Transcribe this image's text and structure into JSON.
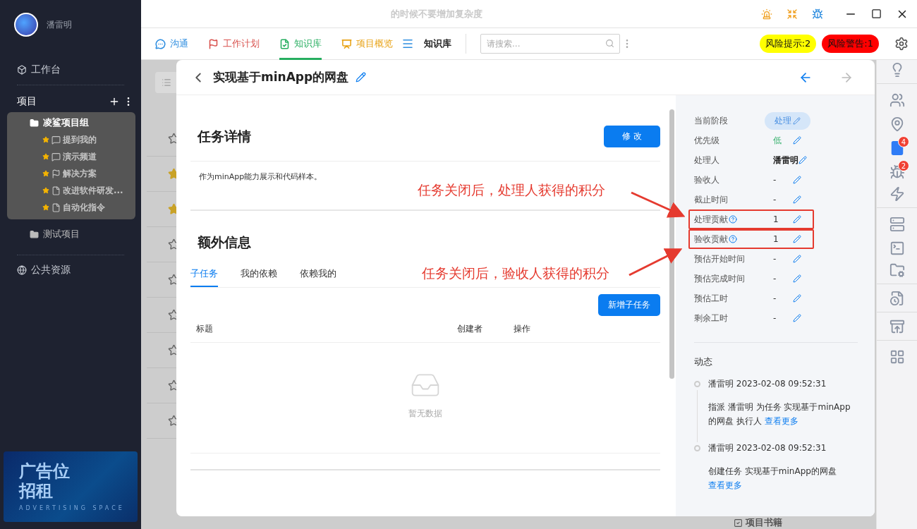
{
  "sidebar": {
    "user": {
      "name": "潘雷明"
    },
    "workbench": "工作台",
    "projects_header": "项目",
    "projects": [
      {
        "label": "凌鲨项目组",
        "selected": true,
        "children": [
          {
            "label": "提到我的",
            "kind": "channel",
            "starred": true
          },
          {
            "label": "演示频道",
            "kind": "channel",
            "starred": true
          },
          {
            "label": "解决方案",
            "kind": "plan",
            "starred": true
          },
          {
            "label": "改进软件研发...",
            "kind": "doc",
            "starred": true
          },
          {
            "label": "自动化指令",
            "kind": "doc",
            "starred": true
          }
        ]
      },
      {
        "label": "测试项目",
        "selected": false
      }
    ],
    "public": "公共资源",
    "ad": {
      "line1": "广告位",
      "line2": "招租",
      "caption": "ADVERTISING SPACE"
    }
  },
  "window": {
    "title": "的时候不要增加复杂度"
  },
  "nav": {
    "tabs": [
      {
        "label": "沟通",
        "color": "#2f8ee0",
        "selected": false
      },
      {
        "label": "工作计划",
        "color": "#d9534f",
        "selected": false
      },
      {
        "label": "知识库",
        "color": "#27ae60",
        "selected": true
      },
      {
        "label": "项目概览",
        "color": "#e8a317",
        "selected": false
      }
    ],
    "current": "知识库",
    "search": {
      "placeholder": "请搜索..."
    },
    "risks": [
      {
        "label": "风险提示:2",
        "color": "#ffff00"
      },
      {
        "label": "风险警告:1",
        "color": "#ff0000"
      }
    ]
  },
  "backdrop": {
    "rows": [
      {
        "starred": false
      },
      {
        "starred": true
      },
      {
        "starred": true
      },
      {
        "starred": false
      },
      {
        "starred": false
      },
      {
        "starred": false
      },
      {
        "starred": false
      },
      {
        "starred": false
      },
      {
        "starred": false
      }
    ],
    "footer": "项目书籍"
  },
  "modal": {
    "title": "实现基于minApp的网盘",
    "nav": [
      {
        "disabled": false
      },
      {
        "disabled": true
      }
    ],
    "details": {
      "heading": "任务详情",
      "edit_button": "修 改",
      "description": "作为minApp能力展示和代码样本。"
    },
    "extra": {
      "heading": "额外信息",
      "tabs": [
        {
          "label": "子任务",
          "selected": true
        },
        {
          "label": "我的依赖",
          "selected": false
        },
        {
          "label": "依赖我的",
          "selected": false
        }
      ],
      "add_button": "新增子任务",
      "columns": [
        "标题",
        "创建者",
        "操作"
      ],
      "empty": "暂无数据"
    },
    "fields": [
      {
        "label": "当前阶段",
        "value": "处理",
        "kind": "stage",
        "help": false,
        "highlighted": false
      },
      {
        "label": "优先级",
        "value": "低",
        "kind": "priority",
        "help": false,
        "highlighted": false
      },
      {
        "label": "处理人",
        "value": "潘雷明",
        "kind": "person",
        "help": false,
        "highlighted": false
      },
      {
        "label": "验收人",
        "value": "-",
        "kind": "plain",
        "help": false,
        "highlighted": false
      },
      {
        "label": "截止时间",
        "value": "-",
        "kind": "plain",
        "help": false,
        "highlighted": false
      },
      {
        "label": "处理贡献",
        "value": "1",
        "kind": "plain",
        "help": true,
        "highlighted": true
      },
      {
        "label": "验收贡献",
        "value": "1",
        "kind": "plain",
        "help": true,
        "highlighted": true
      },
      {
        "label": "预估开始时间",
        "value": "-",
        "kind": "plain",
        "help": false,
        "highlighted": false
      },
      {
        "label": "预估完成时间",
        "value": "-",
        "kind": "plain",
        "help": false,
        "highlighted": false
      },
      {
        "label": "预估工时",
        "value": "-",
        "kind": "plain",
        "help": false,
        "highlighted": false
      },
      {
        "label": "剩余工时",
        "value": "-",
        "kind": "plain",
        "help": false,
        "highlighted": false
      }
    ],
    "activity": {
      "heading": "动态",
      "events": [
        {
          "header": "潘雷明 2023-02-08 09:52:31",
          "text": "指派 潘雷明 为任务 实现基于minApp的网盘 执行人",
          "link": "查看更多"
        },
        {
          "header": "潘雷明 2023-02-08 09:52:31",
          "text": "创建任务 实现基于minApp的网盘",
          "link": "查看更多"
        }
      ]
    }
  },
  "annotations": [
    {
      "text": "任务关闭后，处理人获得的积分"
    },
    {
      "text": "任务关闭后，验收人获得的积分"
    }
  ],
  "right_rail": [
    {
      "selected": false
    },
    {
      "selected": false
    },
    {
      "selected": false
    },
    {
      "selected": true,
      "badge": "4"
    },
    {
      "selected": false,
      "badge": "2"
    },
    {
      "selected": false
    },
    {
      "selected": false
    },
    {
      "selected": false
    },
    {
      "selected": false
    },
    {
      "selected": false
    },
    {
      "selected": false
    },
    {
      "selected": false
    }
  ]
}
